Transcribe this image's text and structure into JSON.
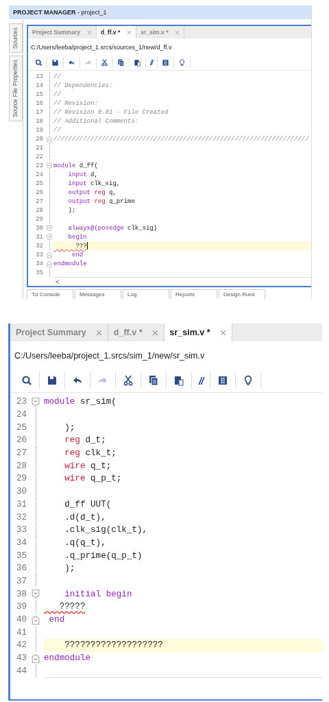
{
  "top_window": {
    "header": {
      "title": "**PROJECT MANAGER** - project_1"
    },
    "side_tabs": [
      {
        "label": "Sources"
      },
      {
        "label": "Source File Properties"
      }
    ],
    "editor": {
      "tabs": [
        {
          "label": "Project Summary",
          "selected": false
        },
        {
          "label": "d_ff.v *",
          "selected": true
        },
        {
          "label": "sr_sim.v *",
          "selected": false
        }
      ],
      "path": "C:/Users/leeba/project_1.srcs/sources_1/new/d_ff.v",
      "toolbar": [
        {
          "kind": "search",
          "disabled": false
        },
        {
          "kind": "save",
          "disabled": false
        },
        {
          "kind": "undo",
          "disabled": false
        },
        {
          "kind": "redo",
          "disabled": true
        },
        {
          "kind": "cut",
          "disabled": false
        },
        {
          "kind": "copy",
          "disabled": false
        },
        {
          "kind": "paste",
          "disabled": false
        },
        {
          "kind": "comment",
          "label": "//",
          "disabled": false
        },
        {
          "kind": "columns",
          "disabled": false
        },
        {
          "kind": "bulb",
          "disabled": false
        }
      ],
      "lines": [
        {
          "number": "13",
          "kind": "plain",
          "current": false,
          "cursor": false,
          "tokens": [
            {
              "kind": "comment",
              "text": "//"
            }
          ]
        },
        {
          "number": "14",
          "kind": "plain",
          "current": false,
          "cursor": false,
          "tokens": [
            {
              "kind": "comment",
              "text": "// Dependencies:"
            }
          ]
        },
        {
          "number": "15",
          "kind": "plain",
          "current": false,
          "cursor": false,
          "tokens": [
            {
              "kind": "comment",
              "text": "//"
            }
          ]
        },
        {
          "number": "16",
          "kind": "plain",
          "current": false,
          "cursor": false,
          "tokens": [
            {
              "kind": "comment",
              "text": "// Revision:"
            }
          ]
        },
        {
          "number": "17",
          "kind": "plain",
          "current": false,
          "cursor": false,
          "tokens": [
            {
              "kind": "comment",
              "text": "// Revision 0.01 - File Created"
            }
          ]
        },
        {
          "number": "18",
          "kind": "plain",
          "current": false,
          "cursor": false,
          "tokens": [
            {
              "kind": "comment",
              "text": "// Additional Comments:"
            }
          ]
        },
        {
          "number": "19",
          "kind": "plain",
          "current": false,
          "cursor": false,
          "tokens": [
            {
              "kind": "comment",
              "text": "//"
            }
          ]
        },
        {
          "number": "20",
          "kind": "fold_end",
          "current": false,
          "cursor": false,
          "tokens": [
            {
              "kind": "comment",
              "text": "/////////////////////////////////////////////////////////////////////"
            }
          ]
        },
        {
          "number": "21",
          "kind": "plain",
          "current": false,
          "cursor": false
        },
        {
          "number": "22",
          "kind": "plain",
          "current": false,
          "cursor": false
        },
        {
          "number": "23",
          "kind": "fold_start",
          "current": false,
          "cursor": false,
          "tokens": [
            {
              "kind": "keyword",
              "text": "module"
            },
            {
              "kind": "plain",
              "text": " d_ff("
            }
          ]
        },
        {
          "number": "24",
          "kind": "plain",
          "current": false,
          "cursor": false,
          "tokens": [
            {
              "kind": "keyword",
              "text": "    input"
            },
            {
              "kind": "plain",
              "text": " d,"
            }
          ]
        },
        {
          "number": "25",
          "kind": "plain",
          "current": false,
          "cursor": false,
          "tokens": [
            {
              "kind": "keyword",
              "text": "    input"
            },
            {
              "kind": "plain",
              "text": " clk_sig,"
            }
          ]
        },
        {
          "number": "26",
          "kind": "plain",
          "current": false,
          "cursor": false,
          "tokens": [
            {
              "kind": "keyword",
              "text": "    output"
            },
            {
              "kind": "type",
              "text": " reg"
            },
            {
              "kind": "plain",
              "text": " q,"
            }
          ]
        },
        {
          "number": "27",
          "kind": "plain",
          "current": false,
          "cursor": false,
          "tokens": [
            {
              "kind": "keyword",
              "text": "    output"
            },
            {
              "kind": "type",
              "text": " reg"
            },
            {
              "kind": "plain",
              "text": " q_prime"
            }
          ]
        },
        {
          "number": "28",
          "kind": "plain",
          "current": false,
          "cursor": false,
          "tokens": [
            {
              "kind": "plain",
              "text": "    );"
            }
          ]
        },
        {
          "number": "29",
          "kind": "plain",
          "current": false,
          "cursor": false
        },
        {
          "number": "30",
          "kind": "fold_start",
          "current": false,
          "cursor": false,
          "tokens": [
            {
              "kind": "keyword",
              "text": "    always@(posedge"
            },
            {
              "kind": "plain",
              "text": " clk_sig)"
            }
          ]
        },
        {
          "number": "31",
          "kind": "fold_start",
          "current": false,
          "cursor": false,
          "tokens": [
            {
              "kind": "keyword",
              "text": "    begin"
            }
          ]
        },
        {
          "number": "32",
          "kind": "plain",
          "current": true,
          "cursor": true,
          "tokens": [
            {
              "kind": "error",
              "text": "      ???"
            }
          ]
        },
        {
          "number": "33",
          "kind": "fold_end",
          "current": false,
          "cursor": false,
          "tokens": [
            {
              "kind": "keyword",
              "text": "     end"
            }
          ]
        },
        {
          "number": "34",
          "kind": "fold_end",
          "current": false,
          "cursor": false,
          "tokens": [
            {
              "kind": "keyword",
              "text": "endmodule"
            }
          ]
        },
        {
          "number": "35",
          "kind": "plain",
          "current": false,
          "cursor": false
        }
      ],
      "scroll_arrow": "<"
    },
    "bottom_tabs": [
      {
        "label": "Tcl Console"
      },
      {
        "label": "Messages"
      },
      {
        "label": "Log"
      },
      {
        "label": "Reports"
      },
      {
        "label": "Design Runs"
      }
    ]
  },
  "bottom_window": {
    "editor": {
      "tabs": [
        {
          "label": "Project Summary",
          "selected": false
        },
        {
          "label": "d_ff.v *",
          "selected": false
        },
        {
          "label": "sr_sim.v *",
          "selected": true
        }
      ],
      "path": "C:/Users/leeba/project_1.srcs/sim_1/new/sr_sim.v",
      "toolbar": [
        {
          "kind": "search",
          "disabled": false
        },
        {
          "kind": "save",
          "disabled": false
        },
        {
          "kind": "undo",
          "disabled": false
        },
        {
          "kind": "redo",
          "disabled": true
        },
        {
          "kind": "cut",
          "disabled": false
        },
        {
          "kind": "copy",
          "disabled": false
        },
        {
          "kind": "paste",
          "disabled": false
        },
        {
          "kind": "comment",
          "label": "//",
          "disabled": false
        },
        {
          "kind": "columns",
          "disabled": false
        },
        {
          "kind": "bulb",
          "disabled": false
        }
      ],
      "lines": [
        {
          "number": "23",
          "kind": "fold_start",
          "current": false,
          "cursor": false,
          "tokens": [
            {
              "kind": "keyword",
              "text": "module"
            },
            {
              "kind": "plain",
              "text": " sr_sim("
            }
          ]
        },
        {
          "number": "24",
          "kind": "plain",
          "current": false,
          "cursor": false
        },
        {
          "number": "25",
          "kind": "plain",
          "current": false,
          "cursor": false,
          "tokens": [
            {
              "kind": "plain",
              "text": "    );"
            }
          ]
        },
        {
          "number": "26",
          "kind": "plain",
          "current": false,
          "cursor": false,
          "tokens": [
            {
              "kind": "type",
              "text": "    reg"
            },
            {
              "kind": "plain",
              "text": " d_t;"
            }
          ]
        },
        {
          "number": "27",
          "kind": "plain",
          "current": false,
          "cursor": false,
          "tokens": [
            {
              "kind": "type",
              "text": "    reg"
            },
            {
              "kind": "plain",
              "text": " clk_t;"
            }
          ]
        },
        {
          "number": "28",
          "kind": "plain",
          "current": false,
          "cursor": false,
          "tokens": [
            {
              "kind": "type",
              "text": "    wire"
            },
            {
              "kind": "plain",
              "text": " q_t;"
            }
          ]
        },
        {
          "number": "29",
          "kind": "plain",
          "current": false,
          "cursor": false,
          "tokens": [
            {
              "kind": "type",
              "text": "    wire"
            },
            {
              "kind": "plain",
              "text": " q_p_t;"
            }
          ]
        },
        {
          "number": "30",
          "kind": "plain",
          "current": false,
          "cursor": false
        },
        {
          "number": "31",
          "kind": "plain",
          "current": false,
          "cursor": false,
          "tokens": [
            {
              "kind": "plain",
              "text": "    d_ff UUT("
            }
          ]
        },
        {
          "number": "32",
          "kind": "plain",
          "current": false,
          "cursor": false,
          "tokens": [
            {
              "kind": "plain",
              "text": "    .d(d_t),"
            }
          ]
        },
        {
          "number": "33",
          "kind": "plain",
          "current": false,
          "cursor": false,
          "tokens": [
            {
              "kind": "plain",
              "text": "    .clk_sig(clk_t),"
            }
          ]
        },
        {
          "number": "34",
          "kind": "plain",
          "current": false,
          "cursor": false,
          "tokens": [
            {
              "kind": "plain",
              "text": "    .q(q_t),"
            }
          ]
        },
        {
          "number": "35",
          "kind": "plain",
          "current": false,
          "cursor": false,
          "tokens": [
            {
              "kind": "plain",
              "text": "    .q_prime(q_p_t)"
            }
          ]
        },
        {
          "number": "36",
          "kind": "plain",
          "current": false,
          "cursor": false,
          "tokens": [
            {
              "kind": "plain",
              "text": "    );"
            }
          ]
        },
        {
          "number": "37",
          "kind": "plain",
          "current": false,
          "cursor": false
        },
        {
          "number": "38",
          "kind": "fold_start",
          "current": false,
          "cursor": false,
          "tokens": [
            {
              "kind": "keyword",
              "text": "    initial begin"
            }
          ]
        },
        {
          "number": "39",
          "kind": "plain",
          "current": false,
          "cursor": false,
          "tokens": [
            {
              "kind": "error",
              "text": "   ?????"
            }
          ]
        },
        {
          "number": "40",
          "kind": "fold_end",
          "current": false,
          "cursor": false,
          "tokens": [
            {
              "kind": "keyword",
              "text": " end"
            }
          ]
        },
        {
          "number": "41",
          "kind": "plain",
          "current": false,
          "cursor": false
        },
        {
          "number": "42",
          "kind": "plain",
          "current": true,
          "cursor": false,
          "tokens": [
            {
              "kind": "plain",
              "text": "    ???????????????????"
            }
          ]
        },
        {
          "number": "43",
          "kind": "fold_end",
          "current": false,
          "cursor": false,
          "tokens": [
            {
              "kind": "keyword",
              "text": "endmodule"
            }
          ]
        },
        {
          "number": "44",
          "kind": "plain",
          "current": false,
          "cursor": false
        }
      ]
    }
  }
}
